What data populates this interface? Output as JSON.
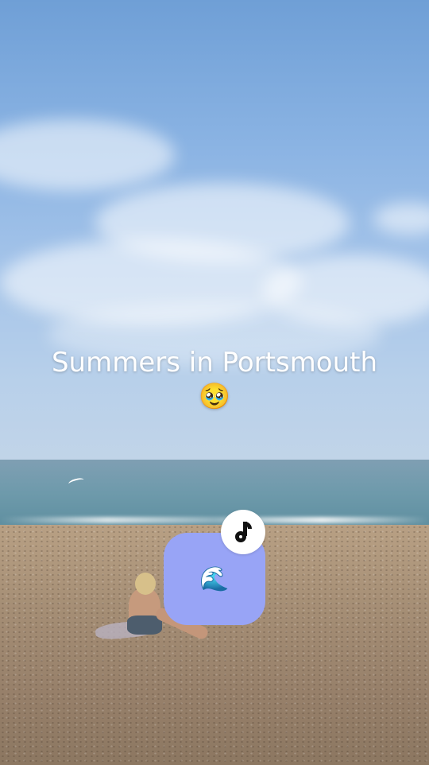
{
  "video": {
    "caption_line1": "Summers in Portsmouth",
    "caption_emoji": "🥹",
    "card_emoji": "🌊",
    "badge_icon": "tiktok-logo-icon"
  },
  "colors": {
    "card": "#98a4f6",
    "badge": "#ffffff",
    "caption": "#ffffff"
  }
}
